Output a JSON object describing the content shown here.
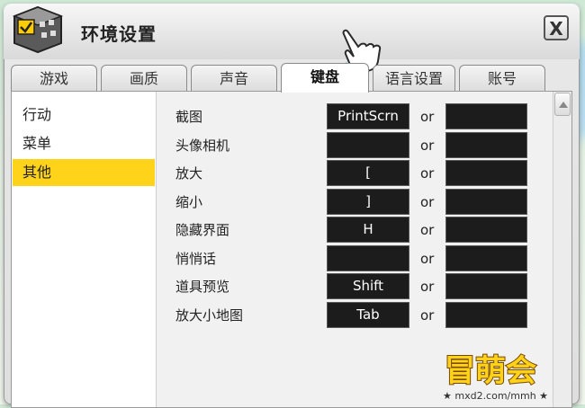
{
  "window": {
    "title": "环境设置",
    "close_label": "X"
  },
  "tabs": [
    {
      "label": "游戏",
      "active": false
    },
    {
      "label": "画质",
      "active": false
    },
    {
      "label": "声音",
      "active": false
    },
    {
      "label": "键盘",
      "active": true
    },
    {
      "label": "语言设置",
      "active": false
    },
    {
      "label": "账号",
      "active": false
    }
  ],
  "sidebar": {
    "items": [
      {
        "label": "行动",
        "selected": false
      },
      {
        "label": "菜单",
        "selected": false
      },
      {
        "label": "其他",
        "selected": true
      }
    ],
    "selected_color": "#ffd31a"
  },
  "keybindings": {
    "or_label": "or",
    "rows": [
      {
        "action": "截图",
        "key1": "PrintScrn",
        "key2": ""
      },
      {
        "action": "头像相机",
        "key1": "",
        "key2": ""
      },
      {
        "action": "放大",
        "key1": "[",
        "key2": ""
      },
      {
        "action": "缩小",
        "key1": "]",
        "key2": ""
      },
      {
        "action": "隐藏界面",
        "key1": "H",
        "key2": ""
      },
      {
        "action": "悄悄话",
        "key1": "",
        "key2": ""
      },
      {
        "action": "道具预览",
        "key1": "Shift",
        "key2": ""
      },
      {
        "action": "放大小地图",
        "key1": "Tab",
        "key2": ""
      }
    ]
  },
  "watermark": {
    "brand_text": "冒萌会",
    "site_text": "★ mxd2.com/mmh ★"
  },
  "icons": {
    "logo": "settings-box-icon",
    "pointer": "hand-pointer-icon",
    "close": "close-icon",
    "scroll_up": "scroll-up-arrow-icon"
  }
}
